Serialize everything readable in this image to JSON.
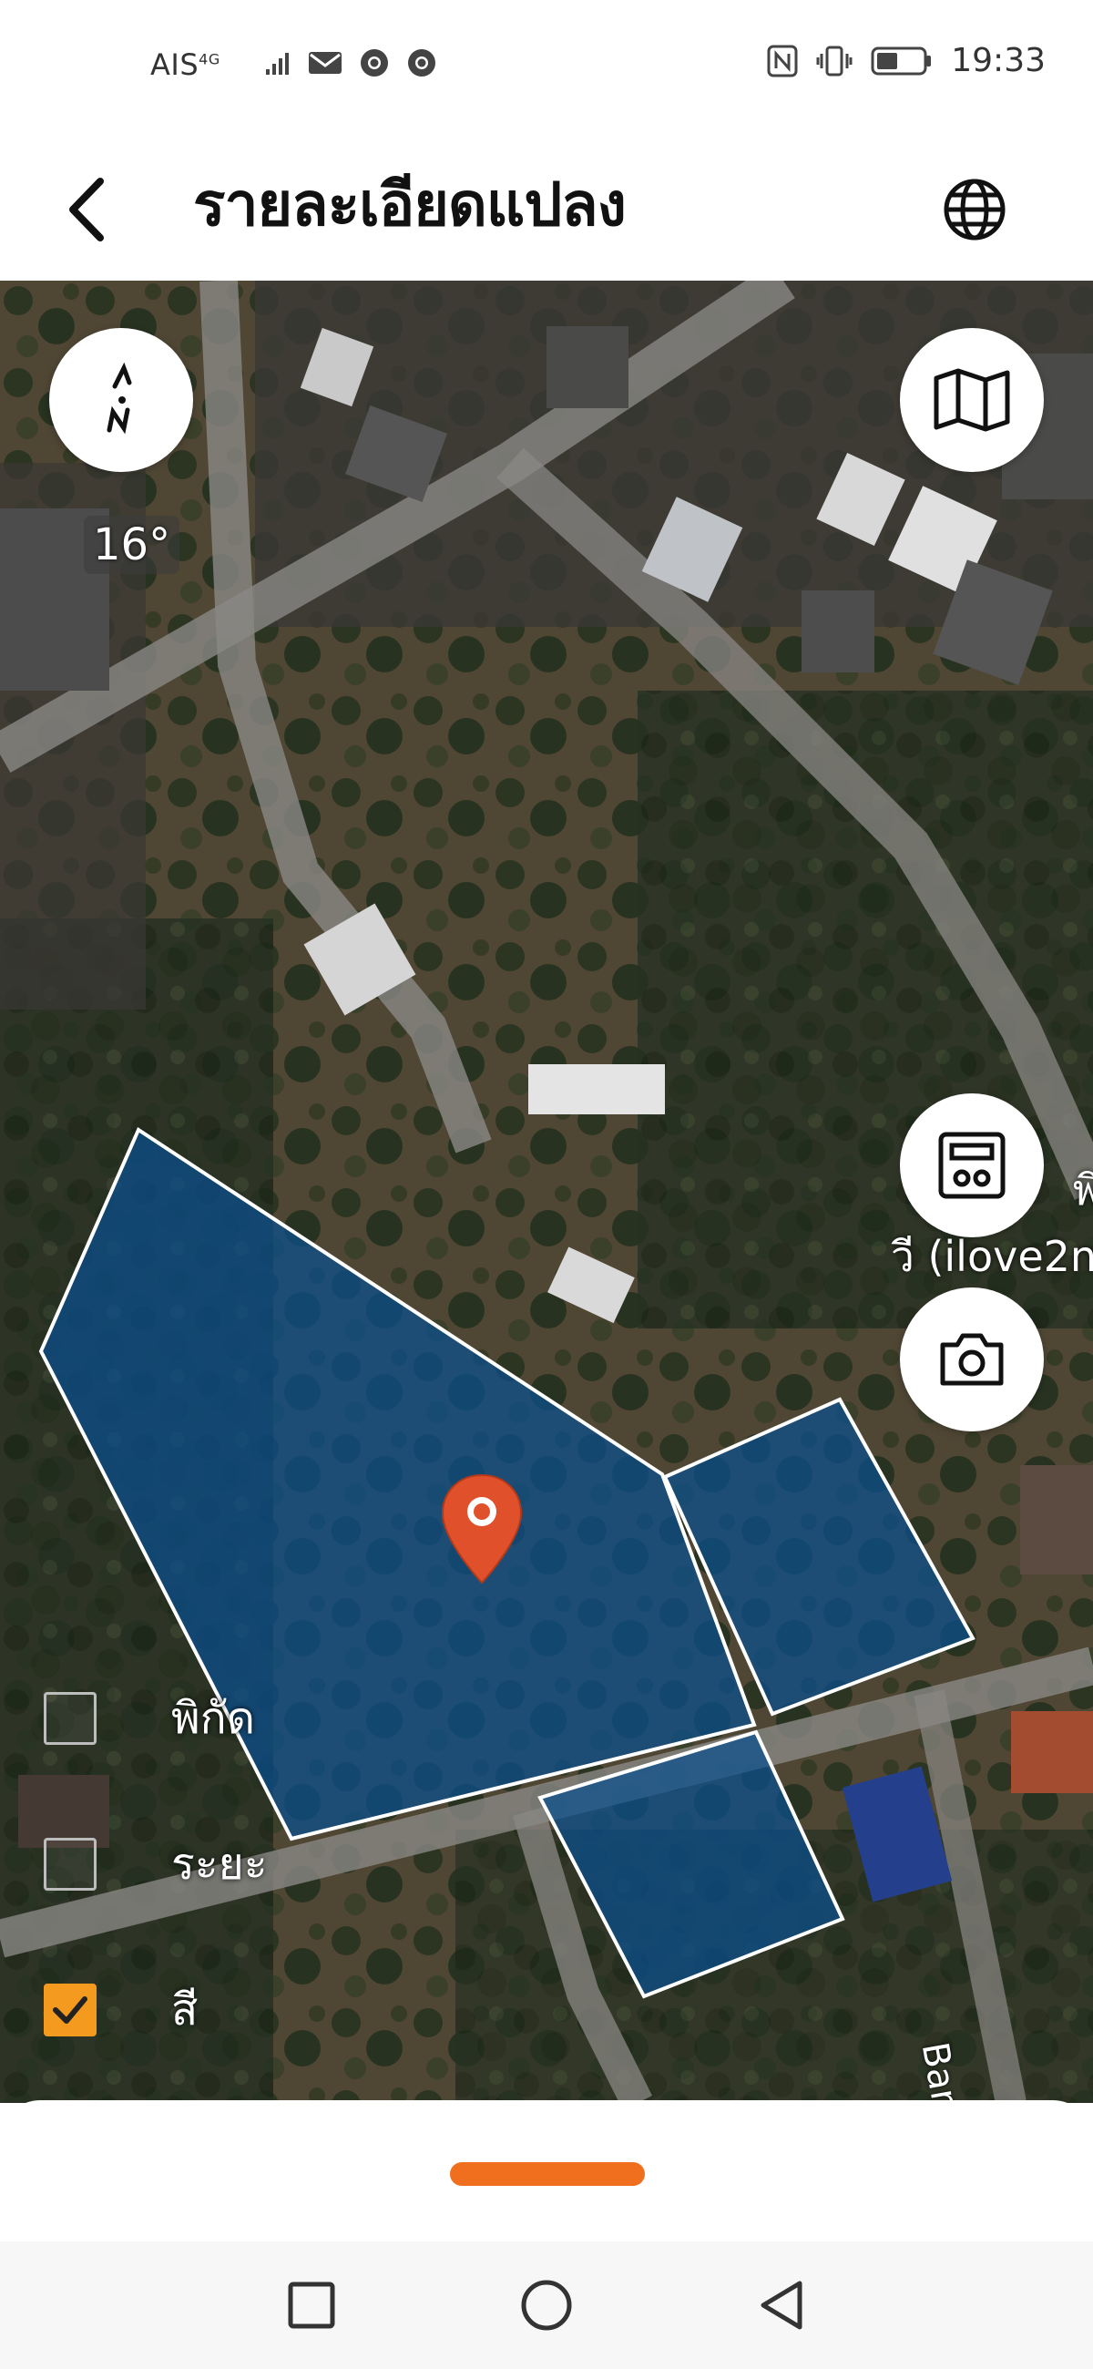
{
  "status_bar": {
    "carrier": "AIS",
    "network": "4G",
    "time": "19:33",
    "icons_left": [
      "signal-icon",
      "mail-icon",
      "chrome-icon",
      "chrome-icon"
    ],
    "icons_right": [
      "nfc-icon",
      "vibrate-icon",
      "battery-icon"
    ]
  },
  "header": {
    "title": "รายละเอียดแปลง",
    "back_icon": "chevron-left-icon",
    "globe_icon": "globe-icon"
  },
  "map": {
    "heading": "16°",
    "place_label": "วี (ilove2n",
    "place_label_top": "พิเค",
    "road_label": "Ban",
    "buttons": [
      "compass-icon",
      "map-icon",
      "calculator-icon",
      "camera-icon"
    ]
  },
  "options": [
    {
      "label": "พิกัด",
      "checked": false
    },
    {
      "label": "ระยะ",
      "checked": false
    },
    {
      "label": "สี",
      "checked": true
    }
  ],
  "colors": {
    "accent": "#f39a1f",
    "handle": "#f06f1f",
    "parcel_fill": "#0a4f8f",
    "pin": "#e0502a"
  }
}
